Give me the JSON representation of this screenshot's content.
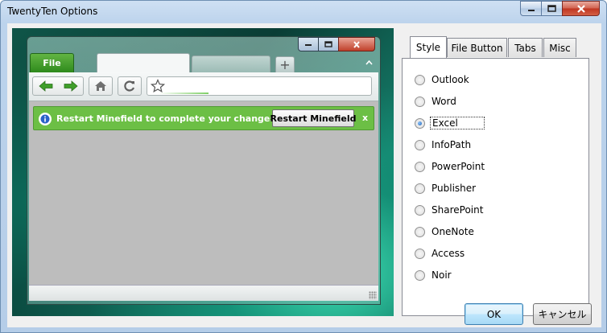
{
  "window": {
    "title": "TwentyTen Options"
  },
  "preview": {
    "file_label": "File",
    "tab_new_symbol": "+",
    "notification_text": "Restart Minefield to complete your changes.",
    "restart_button": "Restart Minefield",
    "notification_close": "x"
  },
  "tabs": [
    {
      "label": "Style",
      "selected": true
    },
    {
      "label": "File Button",
      "selected": false
    },
    {
      "label": "Tabs",
      "selected": false
    },
    {
      "label": "Misc",
      "selected": false
    }
  ],
  "styles": {
    "selected": "Excel",
    "options": [
      "Outlook",
      "Word",
      "Excel",
      "InfoPath",
      "PowerPoint",
      "Publisher",
      "SharePoint",
      "OneNote",
      "Access",
      "Noir"
    ]
  },
  "buttons": {
    "ok": "OK",
    "cancel": "キャンセル"
  },
  "colors": {
    "accent": "#6cbf45",
    "file_button": "#2e8a1c",
    "close_button": "#c0402b"
  }
}
